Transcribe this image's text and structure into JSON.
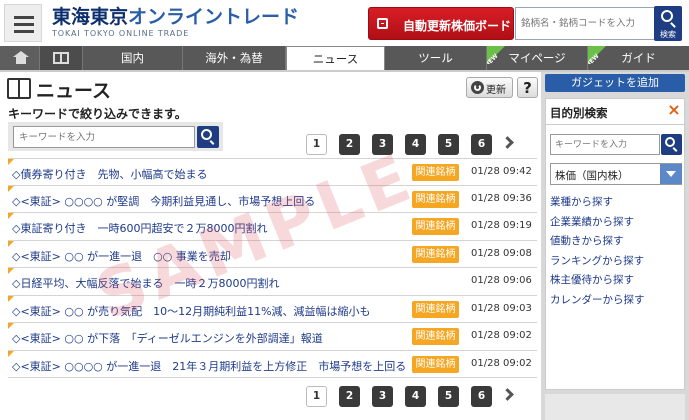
{
  "header": {
    "logo_main_1": "東海東京",
    "logo_main_2": "オンライントレード",
    "logo_sub": "TOKAI TOKYO ONLINE TRADE",
    "auto_update_label": "自動更新株価ボード",
    "search_placeholder": "銘柄名・銘柄コードを入力",
    "search_button_label": "検索"
  },
  "nav": {
    "items": [
      {
        "label": "国内"
      },
      {
        "label": "海外・為替"
      },
      {
        "label": "ニュース"
      },
      {
        "label": "ツール"
      },
      {
        "label": "マイページ"
      },
      {
        "label": "ガイド"
      }
    ],
    "new_badge": "NEW"
  },
  "main": {
    "title": "ニュース",
    "refresh_label": "更新",
    "help_label": "?",
    "subtitle": "キーワードで絞り込みできます。",
    "keyword_placeholder": "キーワードを入力",
    "pages": [
      "1",
      "2",
      "3",
      "4",
      "5",
      "6"
    ],
    "current_page": "1",
    "news": [
      {
        "headline": "◇債券寄り付き　先物、小幅高で始まる",
        "badge": "関連銘柄",
        "time": "01/28 09:42"
      },
      {
        "headline": "◇<東証> ○○○○ が堅調　今期利益見通し、市場予想上回る",
        "badge": "関連銘柄",
        "time": "01/28 09:36"
      },
      {
        "headline": "◇東証寄り付き　一時600円超安で２万8000円割れ",
        "badge": "関連銘柄",
        "time": "01/28 09:19"
      },
      {
        "headline": "◇<東証> ○○ が一進一退　○○ 事業を売却",
        "badge": "関連銘柄",
        "time": "01/28 09:08"
      },
      {
        "headline": "◇日経平均、大幅反落で始まる　一時２万8000円割れ",
        "badge": "",
        "time": "01/28 09:06"
      },
      {
        "headline": "◇<東証> ○○ が売り気配　10～12月期純利益11%減、減益幅は縮小も",
        "badge": "関連銘柄",
        "time": "01/28 09:03"
      },
      {
        "headline": "◇<東証> ○○ が下落　「ディーゼルエンジンを外部調達」報道",
        "badge": "関連銘柄",
        "time": "01/28 09:02"
      },
      {
        "headline": "◇<東証> ○○○○ が一進一退　21年３月期利益を上方修正　市場予想を上回る",
        "badge": "関連銘柄",
        "time": "01/28 09:02"
      }
    ]
  },
  "sidebar": {
    "gadget_label": "ガジェットを追加",
    "panel_title": "目的別検索",
    "close_label": "×",
    "keyword_placeholder": "キーワードを入力",
    "select_value": "株価（国内株）",
    "links": [
      "業種から探す",
      "企業業績から探す",
      "値動きから探す",
      "ランキングから探す",
      "株主優待から探す",
      "カレンダーから探す"
    ]
  },
  "watermark": "SAMPLE",
  "colors": {
    "brand_navy": "#0d2f6e",
    "brand_blue": "#2a5ea8",
    "accent_red": "#c8141c",
    "badge_orange": "#f5a623",
    "nav_gray": "#585858",
    "link_blue": "#1e3a8a"
  },
  "icons": {
    "menu": "hamburger-icon",
    "home": "home-icon",
    "book": "book-icon",
    "search": "search-icon",
    "refresh": "refresh-icon",
    "next": "chevron-right-icon",
    "dropdown": "chevron-down-icon",
    "close": "close-icon"
  }
}
